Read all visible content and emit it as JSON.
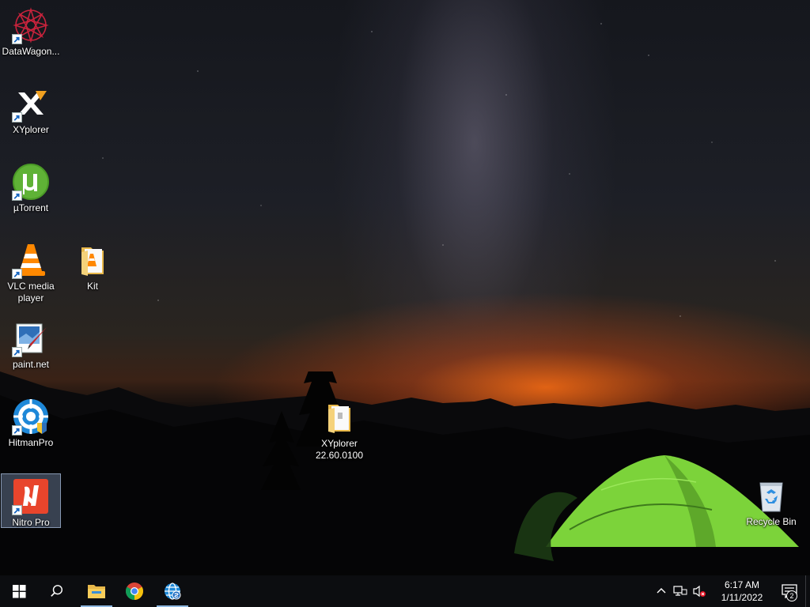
{
  "desktop": {
    "icons": [
      {
        "label": "DataWagon...",
        "icon": "datawagon-icon",
        "shortcut": true
      },
      {
        "label": "XYplorer",
        "icon": "xyplorer-icon",
        "shortcut": true
      },
      {
        "label": "µTorrent",
        "icon": "utorrent-icon",
        "shortcut": true
      },
      {
        "label": "VLC media\nplayer",
        "icon": "vlc-icon",
        "shortcut": true
      },
      {
        "label": "Kit",
        "icon": "folder-icon",
        "shortcut": false
      },
      {
        "label": "paint.net",
        "icon": "paintnet-icon",
        "shortcut": true
      },
      {
        "label": "HitmanPro",
        "icon": "hitmanpro-icon",
        "shortcut": true
      },
      {
        "label": "Nitro Pro",
        "icon": "nitro-pro-icon",
        "shortcut": true,
        "selected": true
      },
      {
        "label": "XYplorer\n22.60.0100",
        "icon": "folder-icon",
        "shortcut": false
      },
      {
        "label": "Recycle Bin",
        "icon": "recycle-bin-icon",
        "shortcut": false
      }
    ]
  },
  "taskbar": {
    "pinned": [
      {
        "name": "File Explorer",
        "icon": "file-explorer-icon"
      },
      {
        "name": "Google Chrome",
        "icon": "chrome-icon"
      },
      {
        "name": "Network app",
        "icon": "network-globe-icon"
      }
    ],
    "clock": {
      "time": "6:17 AM",
      "date": "1/11/2022"
    },
    "notification_count": "2"
  },
  "colors": {
    "taskbar_bg": "#0c0d10",
    "tent_green": "#7cd33a",
    "sunset_orange": "#ff6e14",
    "selection": "#788caa"
  }
}
